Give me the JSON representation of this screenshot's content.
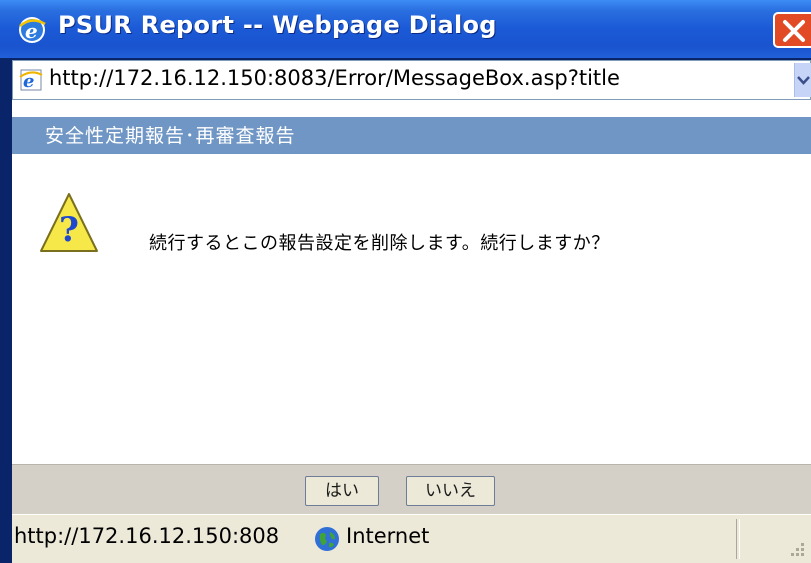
{
  "window": {
    "title": "PSUR Report -- Webpage Dialog"
  },
  "address_bar": {
    "url": "http://172.16.12.150:8083/Error/MessageBox.asp?title"
  },
  "dialog": {
    "header": "安全性定期報告･再審査報告",
    "message": "続行するとこの報告設定を削除します。続行しますか？",
    "buttons": {
      "yes": "はい",
      "no": "いいえ"
    }
  },
  "status_bar": {
    "url": "http://172.16.12.150:808",
    "zone": "Internet"
  },
  "colors": {
    "title_bar": "#1b59d6",
    "header_band": "#6f96c4",
    "close_button": "#e24a25",
    "button_strip": "#d4d0c8"
  },
  "icons": {
    "title": "ie-icon",
    "address": "ie-page-icon",
    "dialog": "warning-question-icon",
    "zone": "globe-icon"
  }
}
